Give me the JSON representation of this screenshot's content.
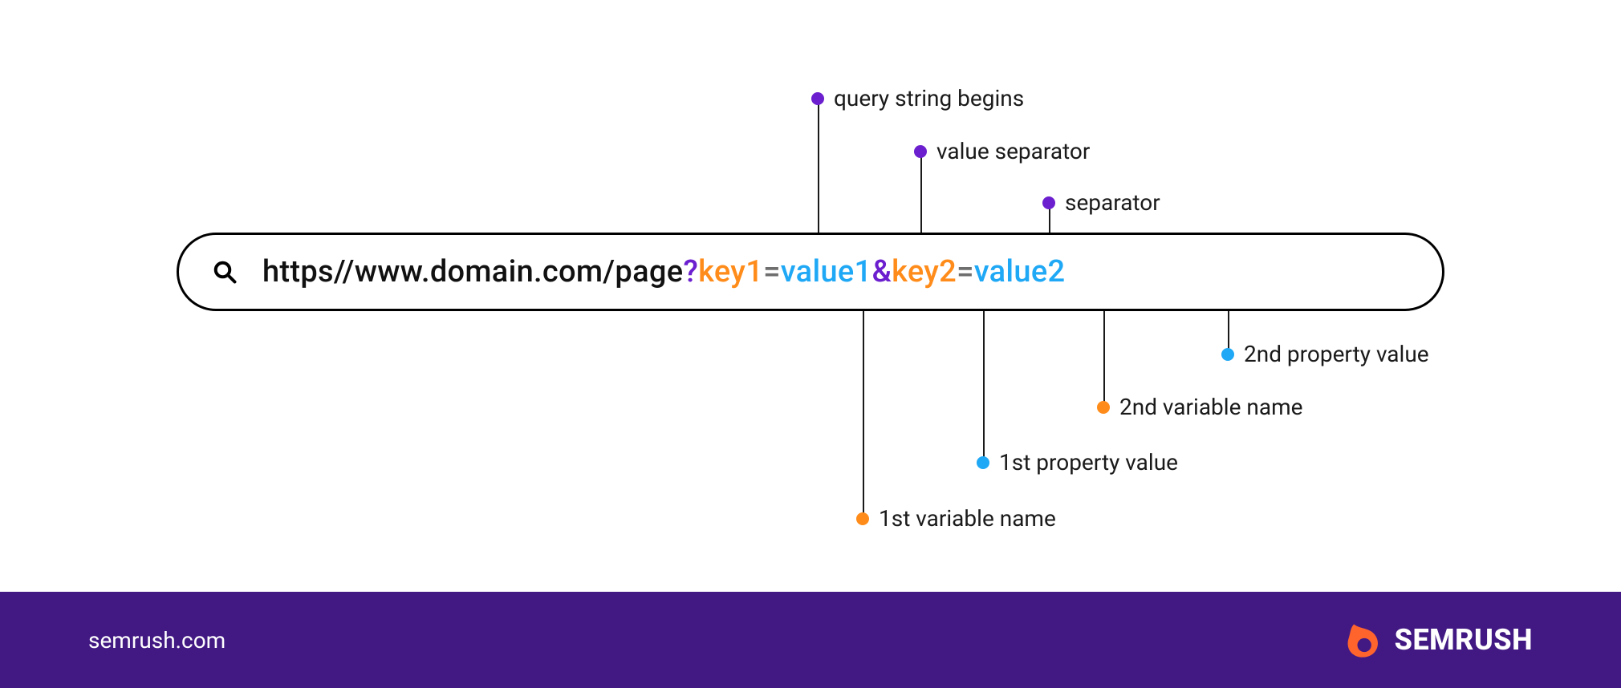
{
  "url": {
    "base": "https//www.domain.com/page",
    "qmark": "?",
    "key1": "key1",
    "eq1": "=",
    "val1": "value1",
    "amp": "&",
    "key2": "key2",
    "eq2": "=",
    "val2": "value2"
  },
  "annotations": {
    "top": [
      {
        "label": "query string begins",
        "color": "purple"
      },
      {
        "label": "value separator",
        "color": "purple"
      },
      {
        "label": "separator",
        "color": "purple"
      }
    ],
    "bottom": [
      {
        "label": "2nd property value",
        "color": "blue"
      },
      {
        "label": "2nd variable name",
        "color": "orange"
      },
      {
        "label": "1st property value",
        "color": "blue"
      },
      {
        "label": "1st variable name",
        "color": "orange"
      }
    ]
  },
  "footer": {
    "url": "semrush.com",
    "brand": "SEMRUSH"
  },
  "colors": {
    "purple": "#6b1fce",
    "orange": "#ff8c1a",
    "blue": "#1fa8f5",
    "footer_bg": "#421983"
  }
}
